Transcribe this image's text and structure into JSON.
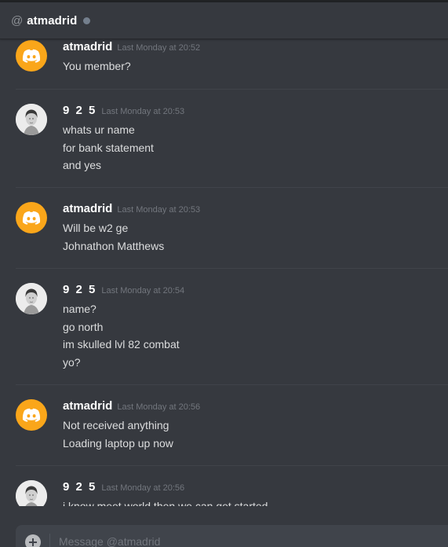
{
  "header": {
    "at_symbol": "@",
    "channel_name": "atmadrid"
  },
  "messages": [
    {
      "author": "atmadrid",
      "avatar": "discord-logo-icon",
      "timestamp": "Last Monday at 20:52",
      "lines": [
        "You member?"
      ]
    },
    {
      "author": "9 2 5",
      "avatar": "profile-photo",
      "timestamp": "Last Monday at 20:53",
      "lines": [
        "whats ur name",
        "for bank statement",
        "and yes"
      ]
    },
    {
      "author": "atmadrid",
      "avatar": "discord-logo-icon",
      "timestamp": "Last Monday at 20:53",
      "lines": [
        "Will be w2 ge",
        "Johnathon  Matthews"
      ]
    },
    {
      "author": "9 2 5",
      "avatar": "profile-photo",
      "timestamp": "Last Monday at 20:54",
      "lines": [
        "name?",
        "go north",
        "im skulled lvl 82 combat",
        "yo?"
      ]
    },
    {
      "author": "atmadrid",
      "avatar": "discord-logo-icon",
      "timestamp": "Last Monday at 20:56",
      "lines": [
        "Not received anything",
        "Loading laptop up now"
      ]
    },
    {
      "author": "9 2 5",
      "avatar": "profile-photo",
      "timestamp": "Last Monday at 20:56",
      "lines": [
        "i know meet world then we can get started"
      ]
    }
  ],
  "composer": {
    "placeholder": "Message @atmadrid",
    "add_icon": "plus-circle-icon"
  },
  "colors": {
    "background": "#36393f",
    "header_text": "#ffffff",
    "message_text": "#dcddde",
    "timestamp": "#72767d",
    "discord_avatar": "#faa61a",
    "status_offline": "#747f8d",
    "composer_bg": "#40444b"
  }
}
